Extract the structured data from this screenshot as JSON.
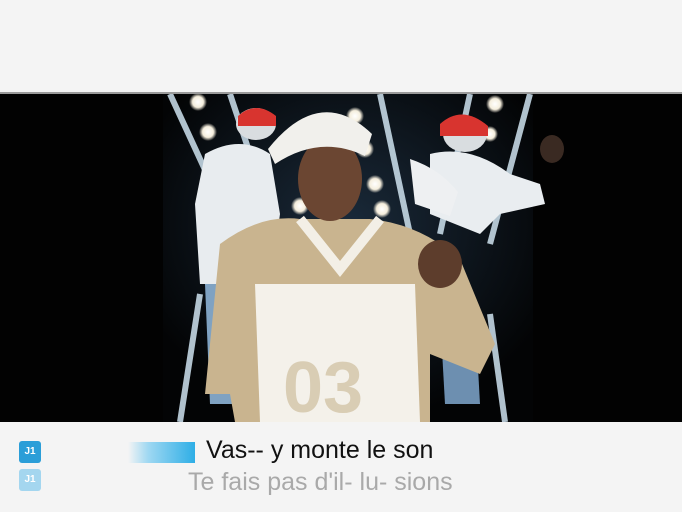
{
  "lyrics": {
    "current_line": "Vas-- y monte le son",
    "next_line": "Te fais pas d'il- lu- sions"
  },
  "players": [
    {
      "label": "J1",
      "color": "#2b9ed8"
    },
    {
      "label": "J1",
      "color": "#a4d6ef"
    }
  ],
  "video": {
    "jersey_number": "03"
  }
}
